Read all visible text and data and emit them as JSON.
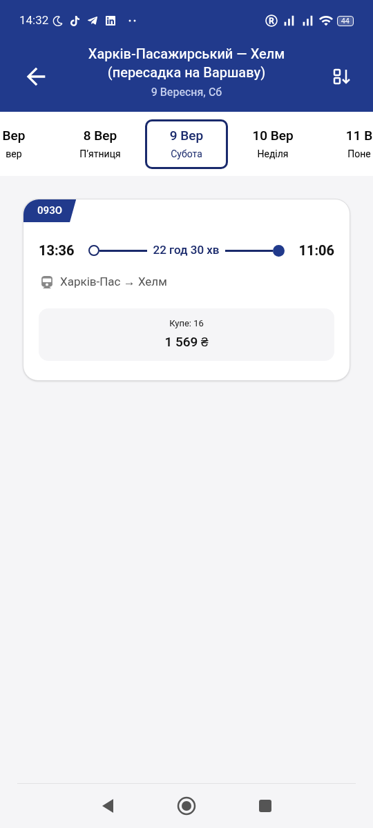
{
  "status_bar": {
    "time": "14:32",
    "battery": "44"
  },
  "header": {
    "title": "Харків-Пасажирський — Хелм (пересадка на Варшаву)",
    "subtitle": "9 Вересня, Сб"
  },
  "dates": [
    {
      "date": "Вер",
      "weekday": "вер",
      "selected": false
    },
    {
      "date": "8 Вер",
      "weekday": "П’ятниця",
      "selected": false
    },
    {
      "date": "9 Вер",
      "weekday": "Субота",
      "selected": true
    },
    {
      "date": "10 Вер",
      "weekday": "Неділя",
      "selected": false
    },
    {
      "date": "11 В",
      "weekday": "Поне",
      "selected": false
    }
  ],
  "trains": [
    {
      "number": "093О",
      "departure": "13:36",
      "duration": "22 год 30 хв",
      "arrival": "11:06",
      "route": "Харків-Пас → Хелм",
      "seats": [
        {
          "class": "Купе: 16",
          "price": "1 569 ₴"
        }
      ]
    }
  ]
}
